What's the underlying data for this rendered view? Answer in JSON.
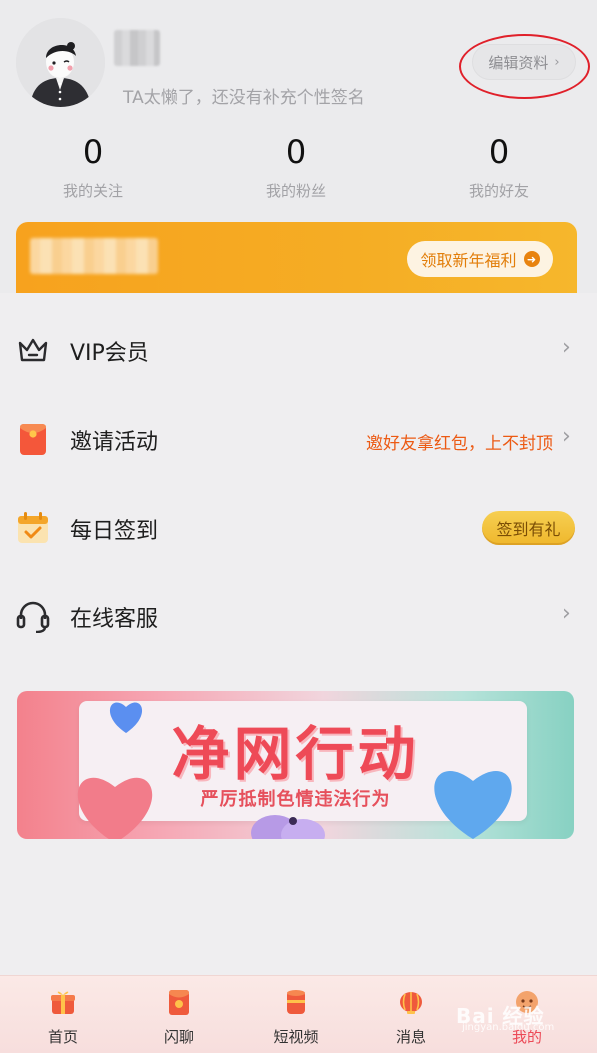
{
  "profile": {
    "signature": "TA太懒了，还没有补充个性签名",
    "edit_label": "编辑资料"
  },
  "stats": [
    {
      "value": "0",
      "label": "我的关注"
    },
    {
      "value": "0",
      "label": "我的粉丝"
    },
    {
      "value": "0",
      "label": "我的好友"
    }
  ],
  "promo": {
    "button_label": "领取新年福利"
  },
  "menu": {
    "vip": {
      "label": "VIP会员",
      "icon": "crown-icon"
    },
    "invite": {
      "label": "邀请活动",
      "extra": "邀好友拿红包，上不封顶",
      "icon": "red-envelope-icon"
    },
    "checkin": {
      "label": "每日签到",
      "badge": "签到有礼",
      "icon": "calendar-check-icon"
    },
    "support": {
      "label": "在线客服",
      "icon": "headset-icon"
    }
  },
  "banner": {
    "title": "净网行动",
    "subtitle": "严厉抵制色情违法行为"
  },
  "nav": [
    {
      "label": "首页",
      "icon": "home-gift-icon"
    },
    {
      "label": "闪聊",
      "icon": "flash-chat-icon"
    },
    {
      "label": "短视频",
      "icon": "video-icon"
    },
    {
      "label": "消息",
      "icon": "message-lantern-icon"
    },
    {
      "label": "我的",
      "icon": "me-icon",
      "active": true
    }
  ],
  "watermark": {
    "text": "Bai 经验",
    "sub": "jingyan.baidu.com"
  },
  "colors": {
    "accent_orange": "#f7a21e",
    "accent_red": "#ec5a14",
    "highlight_circle": "#e0202a",
    "nav_active": "#ec4a57"
  }
}
